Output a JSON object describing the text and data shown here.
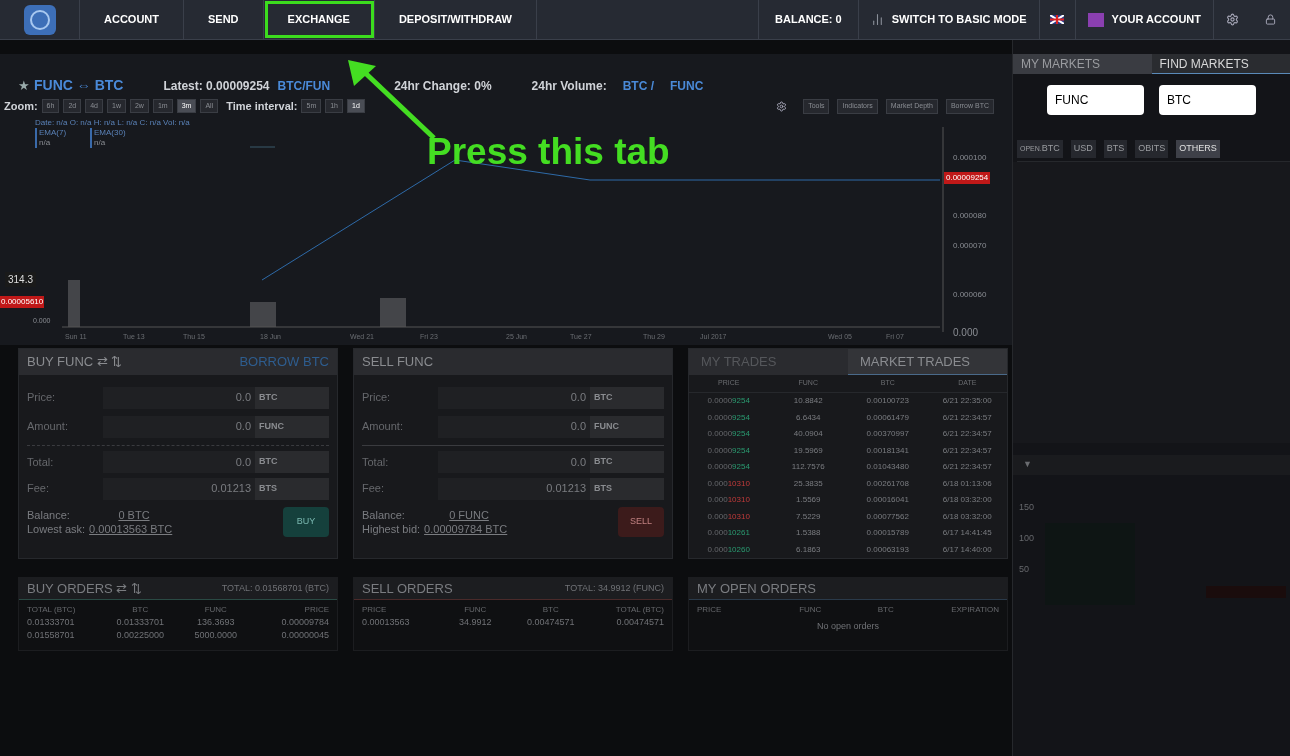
{
  "nav": {
    "items": [
      {
        "label": "ACCOUNT",
        "highlighted": false
      },
      {
        "label": "SEND",
        "highlighted": false
      },
      {
        "label": "EXCHANGE",
        "highlighted": true
      },
      {
        "label": "DEPOSIT/WITHDRAW",
        "highlighted": false
      }
    ],
    "balance": "BALANCE: 0",
    "switch_mode": "SWITCH TO BASIC MODE",
    "account": "YOUR ACCOUNT"
  },
  "annotation": {
    "text": "Press this tab"
  },
  "market": {
    "star": "★",
    "pair": "FUNC ⇔ BTC",
    "latest": "Latest: 0.00009254",
    "latest_unit": "BTC/FUN",
    "change": "24hr Change: 0%",
    "volume_label": "24hr Volume:",
    "volume_units": [
      "BTC /",
      "FUNC"
    ]
  },
  "chart": {
    "zoom_label": "Zoom:",
    "zoom": [
      {
        "label": "6h",
        "selected": false
      },
      {
        "label": "2d",
        "selected": false
      },
      {
        "label": "4d",
        "selected": false
      },
      {
        "label": "1w",
        "selected": false
      },
      {
        "label": "2w",
        "selected": false
      },
      {
        "label": "1m",
        "selected": false
      },
      {
        "label": "3m",
        "selected": true
      },
      {
        "label": "All",
        "selected": false
      }
    ],
    "interval_label": "Time interval:",
    "intervals": [
      {
        "label": "5m",
        "selected": false
      },
      {
        "label": "1h",
        "selected": false
      },
      {
        "label": "1d",
        "selected": true
      }
    ],
    "tools": [
      "Tools",
      "Indicators",
      "Market Depth",
      "Borrow BTC"
    ],
    "legend": "Date: n/a O: n/a H: n/a L: n/a C: n/a Vol: n/a",
    "emas": [
      {
        "name": "EMA(7)",
        "value": "n/a"
      },
      {
        "name": "EMA(30)",
        "value": "n/a"
      }
    ],
    "price_ticks": [
      "0.000100",
      "0.000080",
      "0.000070",
      "0.000060",
      "0.000"
    ],
    "price_marker": "0.00009254",
    "volume_marker": "314.3",
    "volume_price_marker": "0.00005610",
    "volume_zero": "0.000",
    "dates": [
      "Sun 11",
      "Tue 13",
      "Thu 15",
      "18 Jun",
      "Wed 21",
      "Fri 23",
      "25 Jun",
      "Tue 27",
      "Thu 29",
      "Jul 2017",
      "Wed 05",
      "Fri 07"
    ]
  },
  "buy": {
    "title": "BUY FUNC ⇄ ⇅",
    "link": "BORROW BTC",
    "fields": [
      {
        "label": "Price:",
        "value": "0.0",
        "unit": "BTC"
      },
      {
        "label": "Amount:",
        "value": "0.0",
        "unit": "FUNC"
      },
      {
        "label": "Total:",
        "value": "0.0",
        "unit": "BTC"
      },
      {
        "label": "Fee:",
        "value": "0.01213",
        "unit": "BTS"
      }
    ],
    "balance_label": "Balance:",
    "balance": "0 BTC",
    "best_label": "Lowest ask:",
    "best": "0.00013563 BTC",
    "button": "BUY"
  },
  "sell": {
    "title": "SELL FUNC",
    "fields": [
      {
        "label": "Price:",
        "value": "0.0",
        "unit": "BTC"
      },
      {
        "label": "Amount:",
        "value": "0.0",
        "unit": "FUNC"
      },
      {
        "label": "Total:",
        "value": "0.0",
        "unit": "BTC"
      },
      {
        "label": "Fee:",
        "value": "0.01213",
        "unit": "BTS"
      }
    ],
    "balance_label": "Balance:",
    "balance": "0 FUNC",
    "best_label": "Highest bid:",
    "best": "0.00009784 BTC",
    "button": "SELL"
  },
  "trades": {
    "tabs": [
      {
        "label": "MY TRADES",
        "selected": false
      },
      {
        "label": "MARKET TRADES",
        "selected": true
      }
    ],
    "columns": [
      "PRICE",
      "FUNC",
      "BTC",
      "DATE"
    ],
    "rows": [
      {
        "price_dim": "0.0000",
        "price_sig": "9254",
        "kind": "buy",
        "func": "10.8842",
        "btc": "0.00100723",
        "date": "6/21 22:35:00"
      },
      {
        "price_dim": "0.0000",
        "price_sig": "9254",
        "kind": "buy",
        "func": "6.6434",
        "btc": "0.00061479",
        "date": "6/21 22:34:57"
      },
      {
        "price_dim": "0.0000",
        "price_sig": "9254",
        "kind": "buy",
        "func": "40.0904",
        "btc": "0.00370997",
        "date": "6/21 22:34:57"
      },
      {
        "price_dim": "0.0000",
        "price_sig": "9254",
        "kind": "buy",
        "func": "19.5969",
        "btc": "0.00181341",
        "date": "6/21 22:34:57"
      },
      {
        "price_dim": "0.0000",
        "price_sig": "9254",
        "kind": "buy",
        "func": "112.7576",
        "btc": "0.01043480",
        "date": "6/21 22:34:57"
      },
      {
        "price_dim": "0.000",
        "price_sig": "10310",
        "kind": "sell",
        "func": "25.3835",
        "btc": "0.00261708",
        "date": "6/18 01:13:06"
      },
      {
        "price_dim": "0.000",
        "price_sig": "10310",
        "kind": "sell",
        "func": "1.5569",
        "btc": "0.00016041",
        "date": "6/18 03:32:00"
      },
      {
        "price_dim": "0.000",
        "price_sig": "10310",
        "kind": "sell",
        "func": "7.5229",
        "btc": "0.00077562",
        "date": "6/18 03:32:00"
      },
      {
        "price_dim": "0.000",
        "price_sig": "10261",
        "kind": "buy",
        "func": "1.5388",
        "btc": "0.00015789",
        "date": "6/17 14:41:45"
      },
      {
        "price_dim": "0.000",
        "price_sig": "10260",
        "kind": "buy",
        "func": "6.1863",
        "btc": "0.00063193",
        "date": "6/17 14:40:00"
      }
    ]
  },
  "buy_orders": {
    "title": "BUY ORDERS ⇄ ⇅",
    "total": "TOTAL: 0.01568701 (BTC)",
    "columns": [
      "TOTAL (BTC)",
      "BTC",
      "FUNC",
      "PRICE"
    ],
    "rows": [
      [
        "0.01333701",
        "0.01333701",
        "136.3693",
        "0.00009784"
      ],
      [
        "0.01558701",
        "0.00225000",
        "5000.0000",
        "0.00000045"
      ]
    ]
  },
  "sell_orders": {
    "title": "SELL ORDERS",
    "total": "TOTAL: 34.9912 (FUNC)",
    "columns": [
      "PRICE",
      "FUNC",
      "BTC",
      "TOTAL (BTC)"
    ],
    "rows": [
      [
        "0.00013563",
        "34.9912",
        "0.00474571",
        "0.00474571"
      ]
    ]
  },
  "open_orders": {
    "title": "MY OPEN ORDERS",
    "columns": [
      "PRICE",
      "FUNC",
      "BTC",
      "EXPIRATION"
    ],
    "empty": "No open orders"
  },
  "sidebar": {
    "tabs": [
      {
        "label": "MY MARKETS",
        "selected": false
      },
      {
        "label": "FIND MARKETS",
        "selected": true
      }
    ],
    "search": [
      {
        "value": "FUNC"
      },
      {
        "value": "BTC"
      }
    ],
    "markets": [
      {
        "prefix": "OPEN.",
        "label": "BTC",
        "selected": false
      },
      {
        "label": "USD",
        "selected": false
      },
      {
        "label": "BTS",
        "selected": false
      },
      {
        "label": "OBITS",
        "selected": false
      },
      {
        "label": "OTHERS",
        "selected": true
      }
    ],
    "collapse": "▼",
    "depth_ticks": [
      "150",
      "100",
      "50"
    ]
  }
}
